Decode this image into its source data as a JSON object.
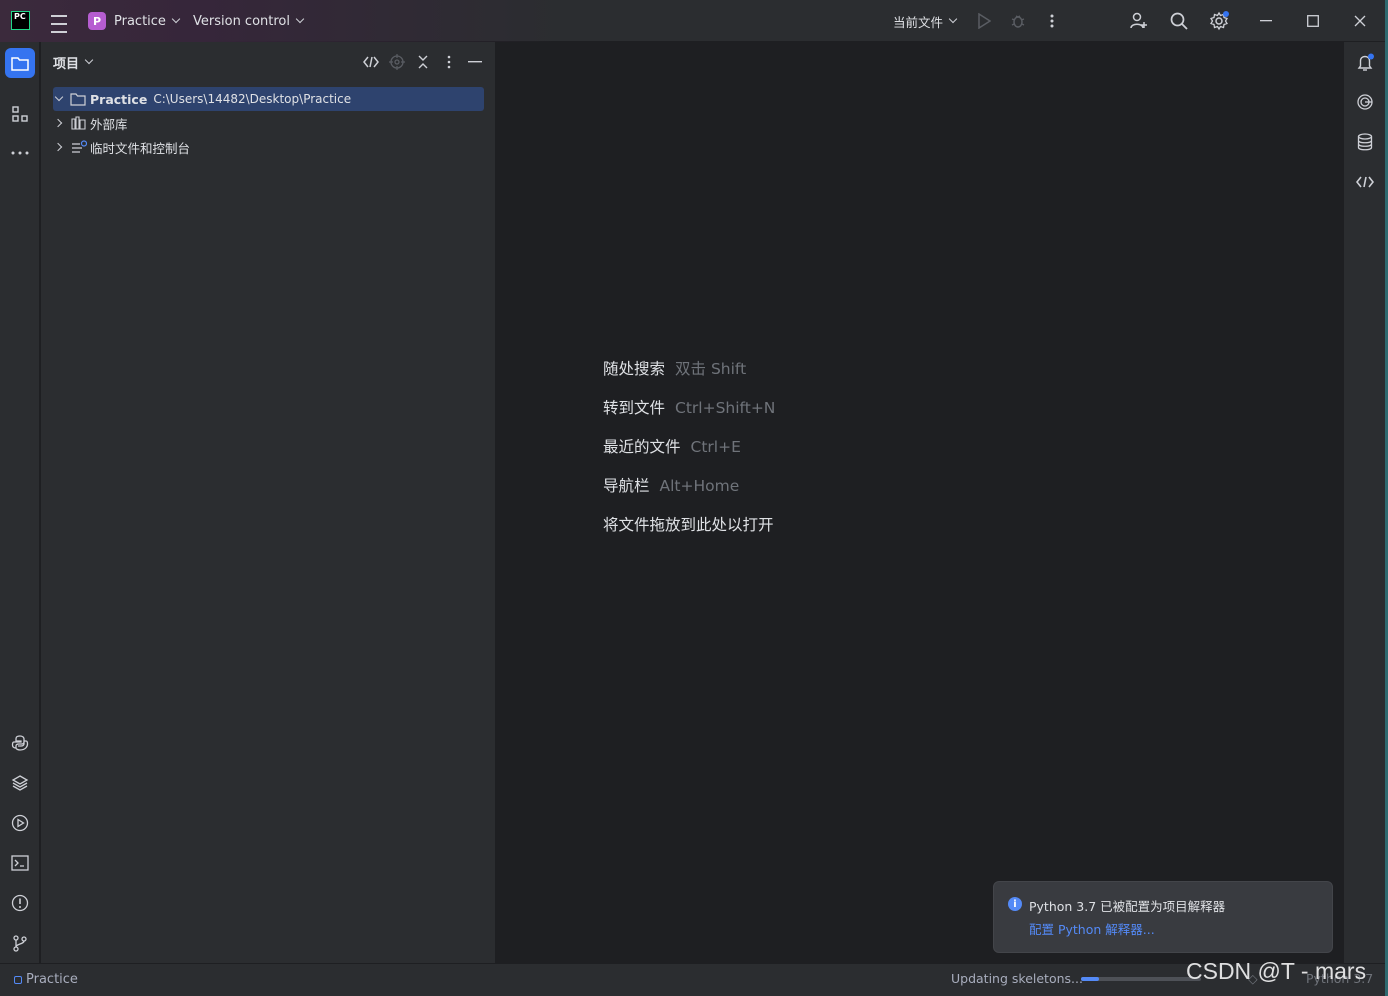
{
  "titlebar": {
    "logo_text": "PC",
    "project_badge": "P",
    "project_name": "Practice",
    "vcs_label": "Version control",
    "run_config": "当前文件"
  },
  "project_panel": {
    "title": "项目",
    "tree": [
      {
        "label": "Practice",
        "path": "C:\\Users\\14482\\Desktop\\Practice",
        "expanded": true,
        "selected": true
      },
      {
        "label": "外部库",
        "expanded": false
      },
      {
        "label": "临时文件和控制台",
        "expanded": false
      }
    ]
  },
  "editor": {
    "hints": [
      {
        "label": "随处搜索",
        "shortcut": "双击 Shift"
      },
      {
        "label": "转到文件",
        "shortcut": "Ctrl+Shift+N"
      },
      {
        "label": "最近的文件",
        "shortcut": "Ctrl+E"
      },
      {
        "label": "导航栏",
        "shortcut": "Alt+Home"
      },
      {
        "label": "将文件拖放到此处以打开",
        "shortcut": ""
      }
    ]
  },
  "notification": {
    "message": "Python 3.7 已被配置为项目解释器",
    "action": "配置 Python 解释器..."
  },
  "statusbar": {
    "project": "Practice",
    "progress_text": "Updating skeletons...",
    "progress_fraction": 0.15,
    "right_text": "Python 3.7",
    "watermark": "CSDN @T - mars"
  },
  "colors": {
    "accent": "#3574f0",
    "selection": "#2e436e",
    "link": "#548af7",
    "badge": "#b65dd1"
  }
}
